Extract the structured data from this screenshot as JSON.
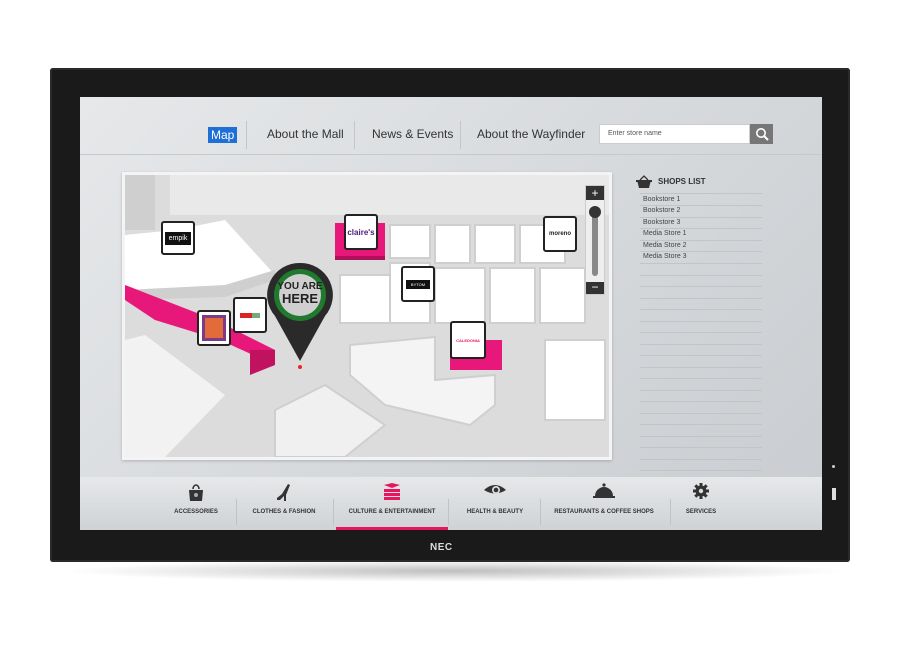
{
  "device": {
    "brand": "NEC"
  },
  "nav": {
    "items": [
      {
        "label": "Map",
        "active": true
      },
      {
        "label": "About the Mall"
      },
      {
        "label": "News & Events"
      },
      {
        "label": "About the Wayfinder"
      }
    ],
    "search": {
      "placeholder": "Enter store name",
      "icon": "search-icon"
    }
  },
  "map": {
    "you_are_here": {
      "line1": "YOU ARE",
      "line2": "HERE"
    },
    "stores": [
      "empik",
      "claire's",
      "BYTOM",
      "CALEDONIA",
      "moreno"
    ],
    "accent": "#e8177a"
  },
  "shops_list": {
    "title": "SHOPS LIST",
    "icon": "basket-icon",
    "items": [
      "Bookstore 1",
      "Bookstore 2",
      "Bookstore 3",
      "Media Store 1",
      "Media Store 2",
      "Media Store 3"
    ]
  },
  "categories": {
    "active_color": "#e8175d",
    "items": [
      {
        "label": "ACCESSORIES",
        "icon": "handbag-icon"
      },
      {
        "label": "CLOTHES & FASHION",
        "icon": "high-heel-icon"
      },
      {
        "label": "CULTURE & ENTERTAINMENT",
        "icon": "books-icon",
        "active": true
      },
      {
        "label": "HEALTH & BEAUTY",
        "icon": "eye-icon"
      },
      {
        "label": "RESTAURANTS & COFFEE SHOPS",
        "icon": "cloche-icon"
      },
      {
        "label": "SERVICES",
        "icon": "gear-icon"
      }
    ]
  }
}
